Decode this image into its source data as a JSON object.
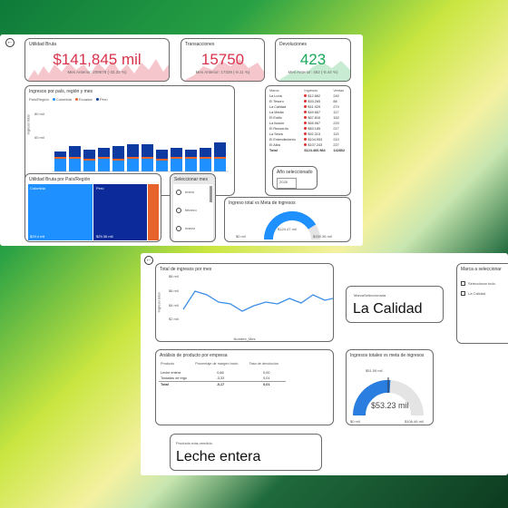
{
  "top": {
    "kpi_utilidad": {
      "title": "Utilidad Bruta",
      "value": "$141,845 mil",
      "sub": "Mes Anterior: 209578 (-32.32 %)"
    },
    "kpi_transacciones": {
      "title": "Transacciones",
      "value": "15750",
      "sub": "Mes Anterior: 17329 (-9.11 %)"
    },
    "kpi_devoluciones": {
      "title": "Devoluciones",
      "value": "423",
      "sub": "Mes Anterior: 462 (-8.44 %)"
    },
    "bar_card": {
      "title": "Ingresos por país, región y mes",
      "legend_label": "País/Región",
      "legend": [
        "Colombia",
        "Ecuador",
        "Perú"
      ],
      "ylabel": "Ingreso total",
      "y_ticks": [
        "80 mil",
        "60 mil"
      ],
      "xlabel": "Nombre_Mes"
    },
    "table": {
      "headers": [
        "Marca",
        "Ingresos",
        "Ventas"
      ],
      "rows": [
        [
          "La Luna",
          "$12.862",
          "240"
        ],
        [
          "El Tesoro",
          "$33.265",
          "88"
        ],
        [
          "La Calidad",
          "$41.929",
          "274"
        ],
        [
          "La Media",
          "$49.667",
          "117"
        ],
        [
          "El Estilo",
          "$67.816",
          "152"
        ],
        [
          "La Ilusión",
          "$65.967",
          "220"
        ],
        [
          "El Recuerdo",
          "$83.185",
          "217"
        ],
        [
          "La Selva",
          "$92.313",
          "113"
        ],
        [
          "El Entendimiento",
          "$104.953",
          "210"
        ],
        [
          "El Alba",
          "$107.243",
          "227"
        ]
      ],
      "total": [
        "Total",
        "$124.466.984",
        "142802"
      ]
    },
    "treemap": {
      "title": "Utilidad Bruta por País/Región",
      "colombia": "Colombia",
      "peru": "Perú",
      "v1": "$29.4 mil",
      "v2": "$29.36 mil"
    },
    "month_slicer": {
      "title": "Seleccionar mes",
      "options": [
        "enero",
        "febrero",
        "marzo"
      ]
    },
    "year": {
      "title": "Año seleccionado",
      "value": "2028"
    },
    "gauge": {
      "title": "Ingreso total vs Meta de ingresos",
      "value": "$124.47 mil",
      "min": "$0 mil",
      "max": "$159.36 mil"
    }
  },
  "bottom": {
    "line_card": {
      "title": "Total de ingresos por mes",
      "y_ticks": [
        "$8 mil",
        "$6 mil",
        "$4 mil",
        "$2 mil"
      ],
      "ylabel": "Ingreso total",
      "xlabel": "Nombre_Mes"
    },
    "brand_card": {
      "label": "MarcaSeleccionada",
      "value": "La Calidad"
    },
    "brand_slicer": {
      "title": "Marca a seleccionar",
      "options": [
        "Seleccionar todo",
        "La Calidad"
      ]
    },
    "product_table": {
      "title": "Análisis de producto por empresa",
      "headers": [
        "Producto",
        "Porcentaje de margen bruto",
        "Tasa de devolución"
      ],
      "rows": [
        [
          "Leche entera",
          "0,66",
          "0,00"
        ],
        [
          "Tostadas de trigo",
          "-3,33",
          "0,01"
        ]
      ],
      "total": [
        "Total",
        "-0,17",
        "0,01"
      ]
    },
    "gauge": {
      "title": "Ingresos totales vs meta de ingresos",
      "target": "$51.59 mil",
      "value": "$53.23 mil",
      "min": "$0 mil",
      "max": "$106.46 mil"
    },
    "product_card": {
      "label": "Producto más vendido",
      "value": "Leche entera"
    }
  },
  "colors": {
    "red": "#d8324a",
    "green": "#1aa85a",
    "bar_blue": "#0d3aa0",
    "bar_light": "#1e90ff",
    "bar_orange": "#e8622c",
    "line_blue": "#3a8ee6"
  }
}
